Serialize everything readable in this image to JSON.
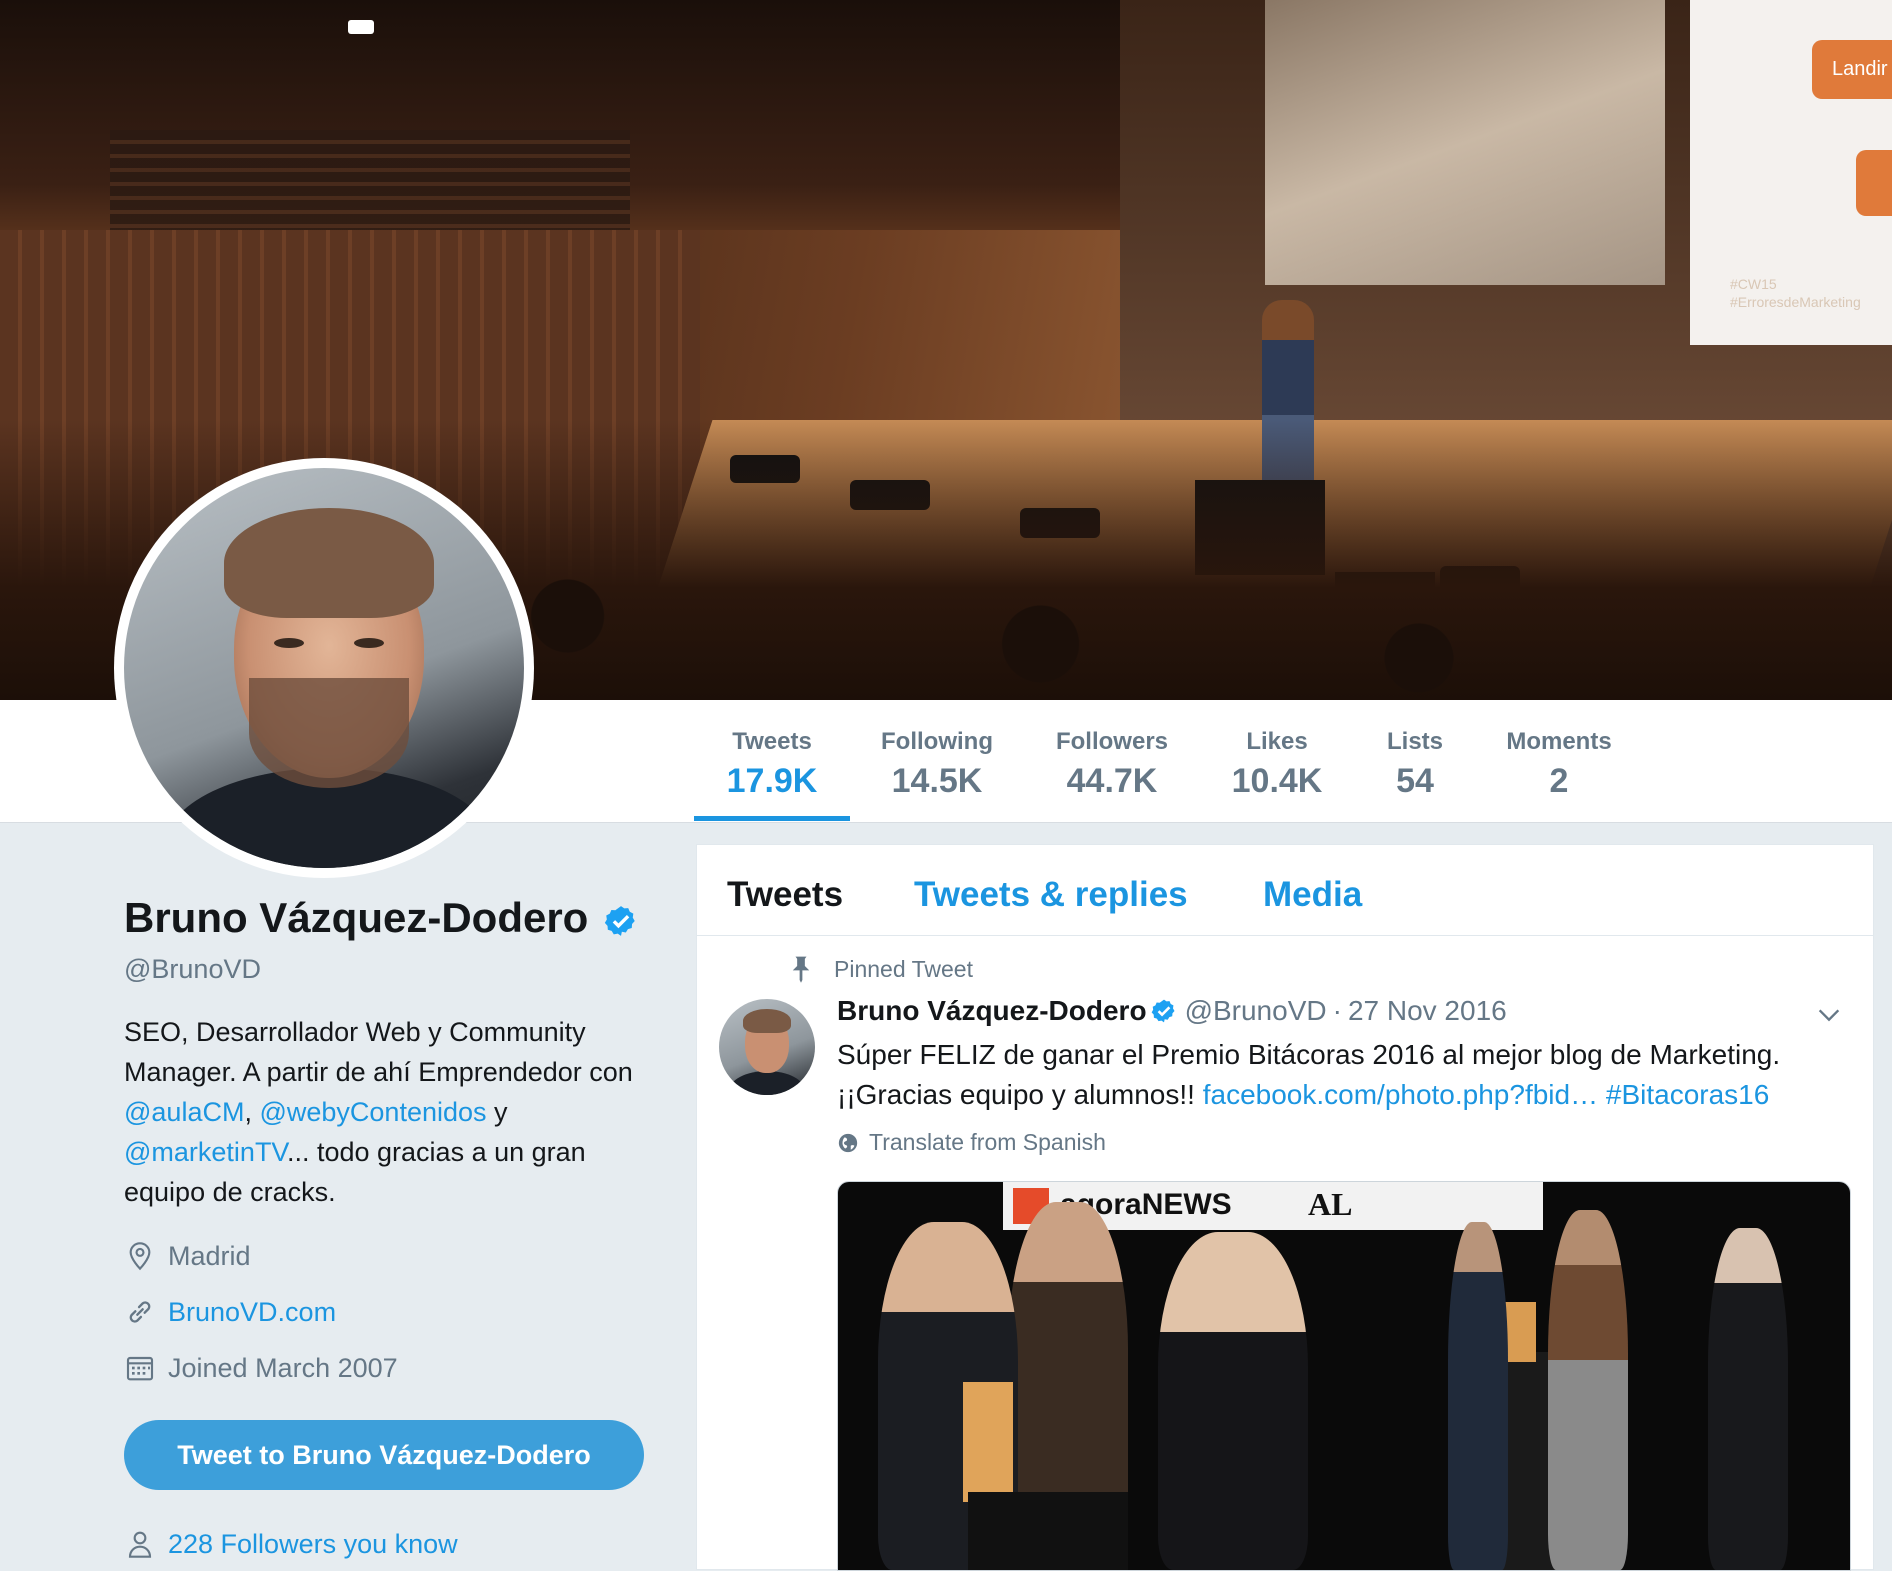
{
  "colors": {
    "accent": "#1b95e0",
    "text": "#14171a",
    "muted": "#657786",
    "background": "#e6ecf0",
    "button": "#3d9fda"
  },
  "header_photo": {
    "slide_button_text": "Landir",
    "slide_hashtags": "#CW15 #ErroresdeMarketing"
  },
  "nav": {
    "items": [
      {
        "label": "Tweets",
        "value": "17.9K",
        "active": true
      },
      {
        "label": "Following",
        "value": "14.5K"
      },
      {
        "label": "Followers",
        "value": "44.7K"
      },
      {
        "label": "Likes",
        "value": "10.4K"
      },
      {
        "label": "Lists",
        "value": "54"
      },
      {
        "label": "Moments",
        "value": "2"
      }
    ]
  },
  "profile": {
    "name": "Bruno Vázquez-Dodero",
    "handle": "@BrunoVD",
    "bio": {
      "part1": "SEO, Desarrollador Web y Community Manager. A partir de ahí Emprendedor con ",
      "mention1": "@aulaCM",
      "sep1": ", ",
      "mention2": "@webyContenidos",
      "sep2": " y ",
      "mention3": "@marketinTV",
      "part2": "... todo gracias a un gran equipo de cracks."
    },
    "location": "Madrid",
    "website": "BrunoVD.com",
    "joined": "Joined March 2007",
    "tweet_to_label": "Tweet to Bruno Vázquez-Dodero",
    "followers_you_know": "228 Followers you know",
    "icons": {
      "location": "location-pin-icon",
      "website": "link-icon",
      "joined": "calendar-icon",
      "followers": "person-icon",
      "verified": "verified-badge-icon"
    }
  },
  "timeline": {
    "tabs": [
      {
        "label": "Tweets",
        "active": true
      },
      {
        "label": "Tweets & replies"
      },
      {
        "label": "Media"
      }
    ],
    "pinned_label": "Pinned Tweet",
    "tweet": {
      "name": "Bruno Vázquez-Dodero",
      "handle": "@BrunoVD",
      "dot": "·",
      "date": "27 Nov 2016",
      "text1": "Súper FELIZ de ganar el Premio Bitácoras 2016 al mejor blog de Marketing. ¡¡Gracias equipo y alumnos!! ",
      "link": "facebook.com/photo.php?fbid…",
      "hashtag": "#Bitacoras16",
      "translate": "Translate from Spanish",
      "media_banner_text": "agoraNEWS",
      "media_banner_text2": "AL"
    }
  }
}
